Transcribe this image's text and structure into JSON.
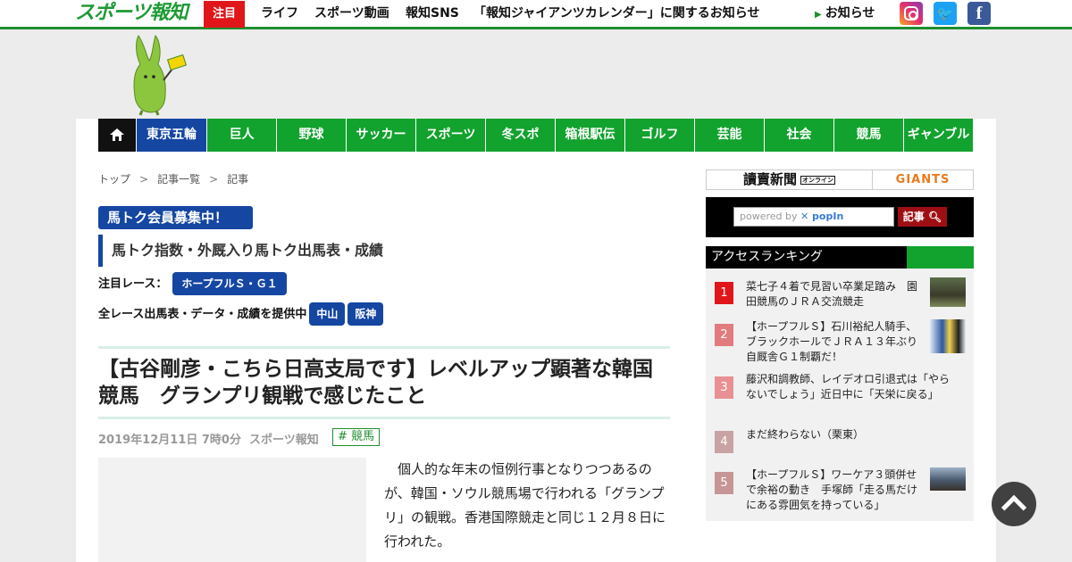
{
  "header": {
    "logo": "スポーツ報知",
    "hot_label": "注目",
    "links": [
      "ライフ",
      "スポーツ動画",
      "報知SNS",
      "「報知ジャイアンツカレンダー」に関するお知らせ"
    ],
    "notice": "お知らせ",
    "sns": [
      "instagram-icon",
      "twitter-icon",
      "facebook-icon"
    ]
  },
  "categories": [
    "東京五輪",
    "巨人",
    "野球",
    "サッカー",
    "スポーツ",
    "冬スポ",
    "箱根駅伝",
    "ゴルフ",
    "芸能",
    "社会",
    "競馬",
    "ギャンブル"
  ],
  "breadcrumb": [
    "トップ",
    "記事一覧",
    "記事"
  ],
  "umatoku": {
    "badge": "馬トク会員募集中！",
    "title": "馬トク指数・外厩入り馬トク出馬表・成績",
    "featured_label": "注目レース：",
    "featured_race": "ホープフルＳ・Ｇ１",
    "allrace_label": "全レース出馬表・データ・成績を提供中",
    "venues": [
      "中山",
      "阪神"
    ]
  },
  "article": {
    "headline": "【古谷剛彦・こちら日高支局です】レベルアップ顕著な韓国競馬　グランプリ観戦で感じたこと",
    "date": "2019年12月11日 7時0分",
    "source": "スポーツ報知",
    "tag": "# 競馬",
    "body": "個人的な年末の恒例行事となりつつあるのが、韓国・ソウル競馬場で行われる「グランプリ」の観戦。香港国際競走と同じ１２月８日に行われた。"
  },
  "sidebar": {
    "ad_left": "讀賣新聞",
    "ad_left_badge": "オンライン",
    "ad_right": "GIANTS",
    "search_placeholder_prefix": "powered by",
    "search_placeholder_brand": "popIn",
    "search_button": "記事",
    "ranking_title": "アクセスランキング",
    "ranking": [
      {
        "rank": "1",
        "text": "菜七子４着で見習い卒業足踏み　園田競馬のＪＲＡ交流競走"
      },
      {
        "rank": "2",
        "text": "【ホープフルＳ】石川裕紀人騎手、ブラックホールでＪＲＡ１３年ぶり自厩舎Ｇ１制覇だ！"
      },
      {
        "rank": "3",
        "text": "藤沢和調教師、レイデオロ引退式は「やらないでしょう」近日中に「天栄に戻る」"
      },
      {
        "rank": "4",
        "text": "まだ終わらない（栗東）"
      },
      {
        "rank": "5",
        "text": "【ホープフルＳ】ワーケア３頭併せで余裕の動き　手塚師「走る馬だけにある雰囲気を持っている」"
      }
    ]
  },
  "colors": {
    "brand_green": "#12a22e",
    "navy": "#1546a2",
    "hot_red": "#e0161b"
  }
}
